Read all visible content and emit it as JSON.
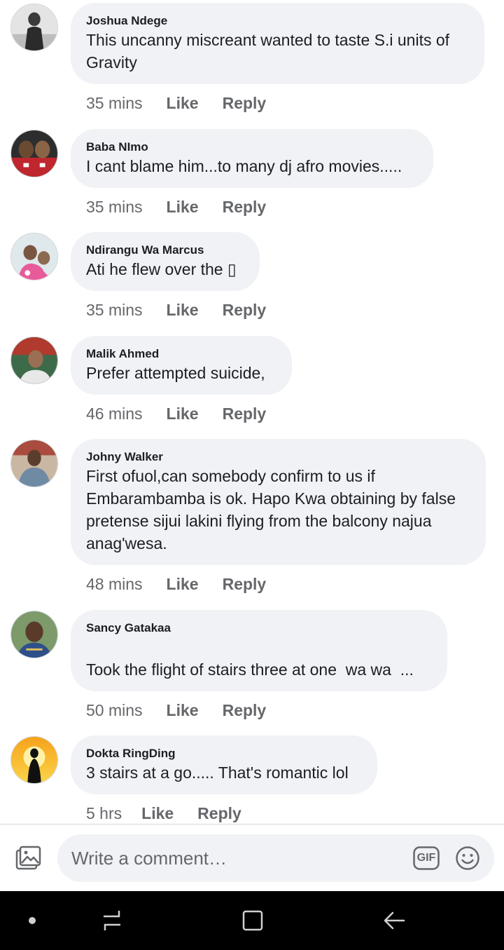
{
  "comments": [
    {
      "author": "Joshua Ndege",
      "text": "This uncanny miscreant wanted to taste S.i units of\nGravity",
      "time": "35 mins",
      "avatar_icon": "user-photo-icon"
    },
    {
      "author": "Baba NImo",
      "text": "I cant blame him...to many dj afro movies.....",
      "time": "35 mins",
      "avatar_icon": "user-photo-icon"
    },
    {
      "author": "Ndirangu Wa Marcus",
      "text": "Ati he flew over the ▯",
      "time": "35 mins",
      "avatar_icon": "user-photo-icon"
    },
    {
      "author": "Malik Ahmed",
      "text": "Prefer attempted suicide,",
      "time": "46 mins",
      "avatar_icon": "user-photo-icon"
    },
    {
      "author": "Johny Walker",
      "text": "First ofuol,can somebody confirm to us if\nEmbarambamba is ok. Hapo Kwa obtaining by false\npretense sijui lakini flying from the balcony najua\nanag'wesa.",
      "time": "48 mins",
      "avatar_icon": "user-photo-icon"
    },
    {
      "author": "Sancy Gatakaa",
      "text": "\nTook the flight of stairs three at one  wa wa  ...",
      "time": "50 mins",
      "avatar_icon": "user-photo-icon"
    },
    {
      "author": "Dokta RingDing",
      "text": "3 stairs at a go..... That's romantic lol",
      "time": "5 hrs",
      "avatar_icon": "user-photo-icon"
    }
  ],
  "actions": {
    "like": "Like",
    "reply": "Reply"
  },
  "composer": {
    "placeholder": "Write a comment…",
    "photo_icon": "photo-icon",
    "gif_label": "GIF",
    "emoji_icon": "smiley-icon"
  },
  "navbar": {
    "icons": [
      "dot-icon",
      "recent-apps-icon",
      "home-icon",
      "back-icon"
    ]
  },
  "colors": {
    "bubble": "#f0f2f5",
    "secondary_text": "#65676b",
    "navbar": "#000000"
  }
}
